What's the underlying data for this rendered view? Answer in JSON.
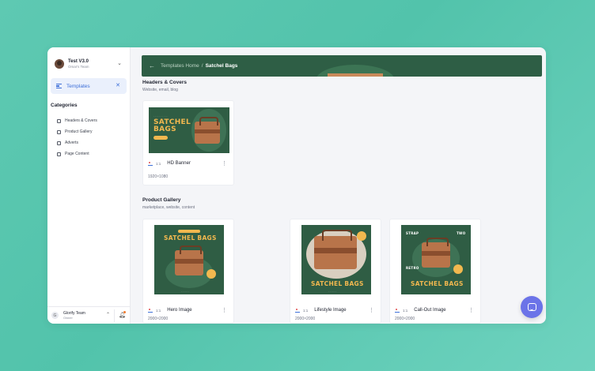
{
  "team": {
    "name": "Test V3.0",
    "subtitle": "Omar's Team"
  },
  "nav": {
    "templates_label": "Templates"
  },
  "categories": {
    "title": "Categories",
    "items": [
      "Headers & Covers",
      "Product Gallery",
      "Adverts",
      "Page Content"
    ]
  },
  "footer": {
    "avatar_letter": "G",
    "org_name": "Glorify Team",
    "role": "Owner"
  },
  "breadcrumb": {
    "home": "Templates Home",
    "separator": "/",
    "current": "Satchel Bags"
  },
  "sections": [
    {
      "title": "Headers & Covers",
      "subtitle": "Website, email, blog",
      "cards": [
        {
          "name": "HD Banner",
          "ratio": "1:1",
          "dims": "1920×1080",
          "thumb_title": "SATCHEL BAGS"
        }
      ]
    },
    {
      "title": "Product Gallery",
      "subtitle": "marketplace, website, content",
      "cards": [
        {
          "name": "Hero Image",
          "ratio": "1:1",
          "dims": "2000×2000",
          "thumb_title": "SATCHEL BAGS"
        },
        {
          "name": "Lifestyle Image",
          "ratio": "1:1",
          "dims": "2000×2000",
          "thumb_title": "SATCHEL BAGS"
        },
        {
          "name": "Call-Out Image",
          "ratio": "1:1",
          "dims": "2000×2000",
          "thumb_title": "SATCHEL BAGS",
          "callout_left": "STRAP",
          "callout_right": "TWO",
          "callout_bottom": "RETRO"
        }
      ]
    }
  ],
  "colors": {
    "brand_green": "#2e5e45",
    "accent_blue": "#3d6fd8",
    "title_yellow": "#f2b84f",
    "chat_purple": "#6b73e8",
    "background_teal": "#52c3ab"
  },
  "icons": [
    "team-avatar-icon",
    "chevron-down-icon",
    "templates-icon",
    "close-icon",
    "checkbox-icon",
    "chevron-up-icon",
    "bell-icon",
    "back-arrow-icon",
    "image-icon",
    "kebab-menu-icon",
    "chat-icon"
  ]
}
